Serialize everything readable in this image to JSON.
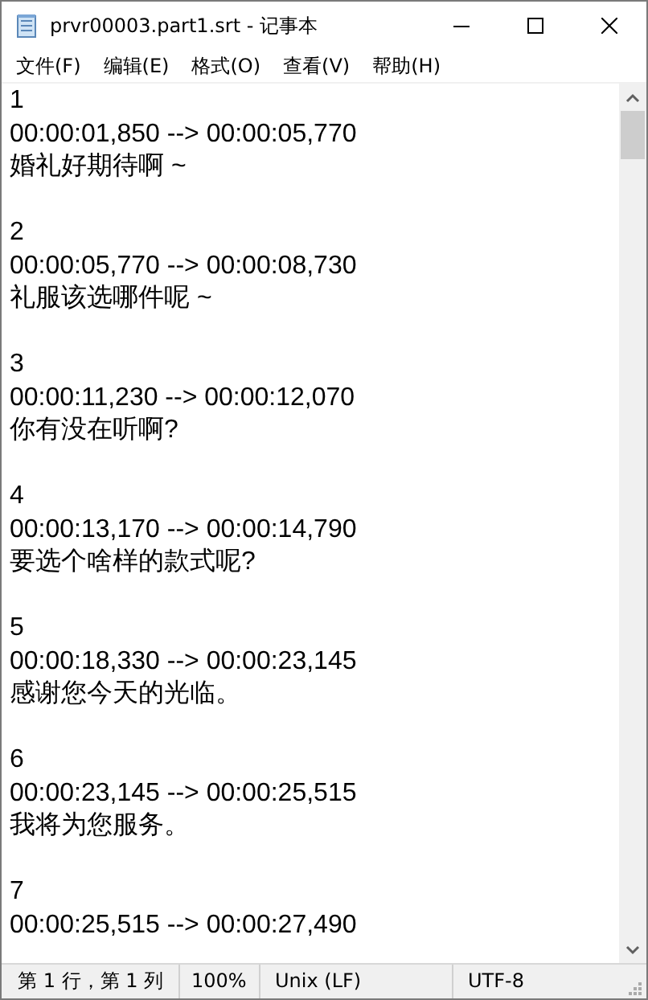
{
  "window": {
    "title": "prvr00003.part1.srt - 记事本"
  },
  "menu": [
    "文件(F)",
    "编辑(E)",
    "格式(O)",
    "查看(V)",
    "帮助(H)"
  ],
  "subtitles": [
    {
      "index": "1",
      "time": "00:00:01,850 --> 00:00:05,770",
      "text": "婚礼好期待啊 ~"
    },
    {
      "index": "2",
      "time": "00:00:05,770 --> 00:00:08,730",
      "text": "礼服该选哪件呢 ~"
    },
    {
      "index": "3",
      "time": "00:00:11,230 --> 00:00:12,070",
      "text": "你有没在听啊?"
    },
    {
      "index": "4",
      "time": "00:00:13,170 --> 00:00:14,790",
      "text": "要选个啥样的款式呢?"
    },
    {
      "index": "5",
      "time": "00:00:18,330 --> 00:00:23,145",
      "text": "感谢您今天的光临。"
    },
    {
      "index": "6",
      "time": "00:00:23,145 --> 00:00:25,515",
      "text": "我将为您服务。"
    },
    {
      "index": "7",
      "time": "00:00:25,515 --> 00:00:27,490"
    }
  ],
  "status_bar": [
    "第 1 行，第 1 列",
    "100%",
    "Unix (LF)",
    "UTF-8"
  ]
}
